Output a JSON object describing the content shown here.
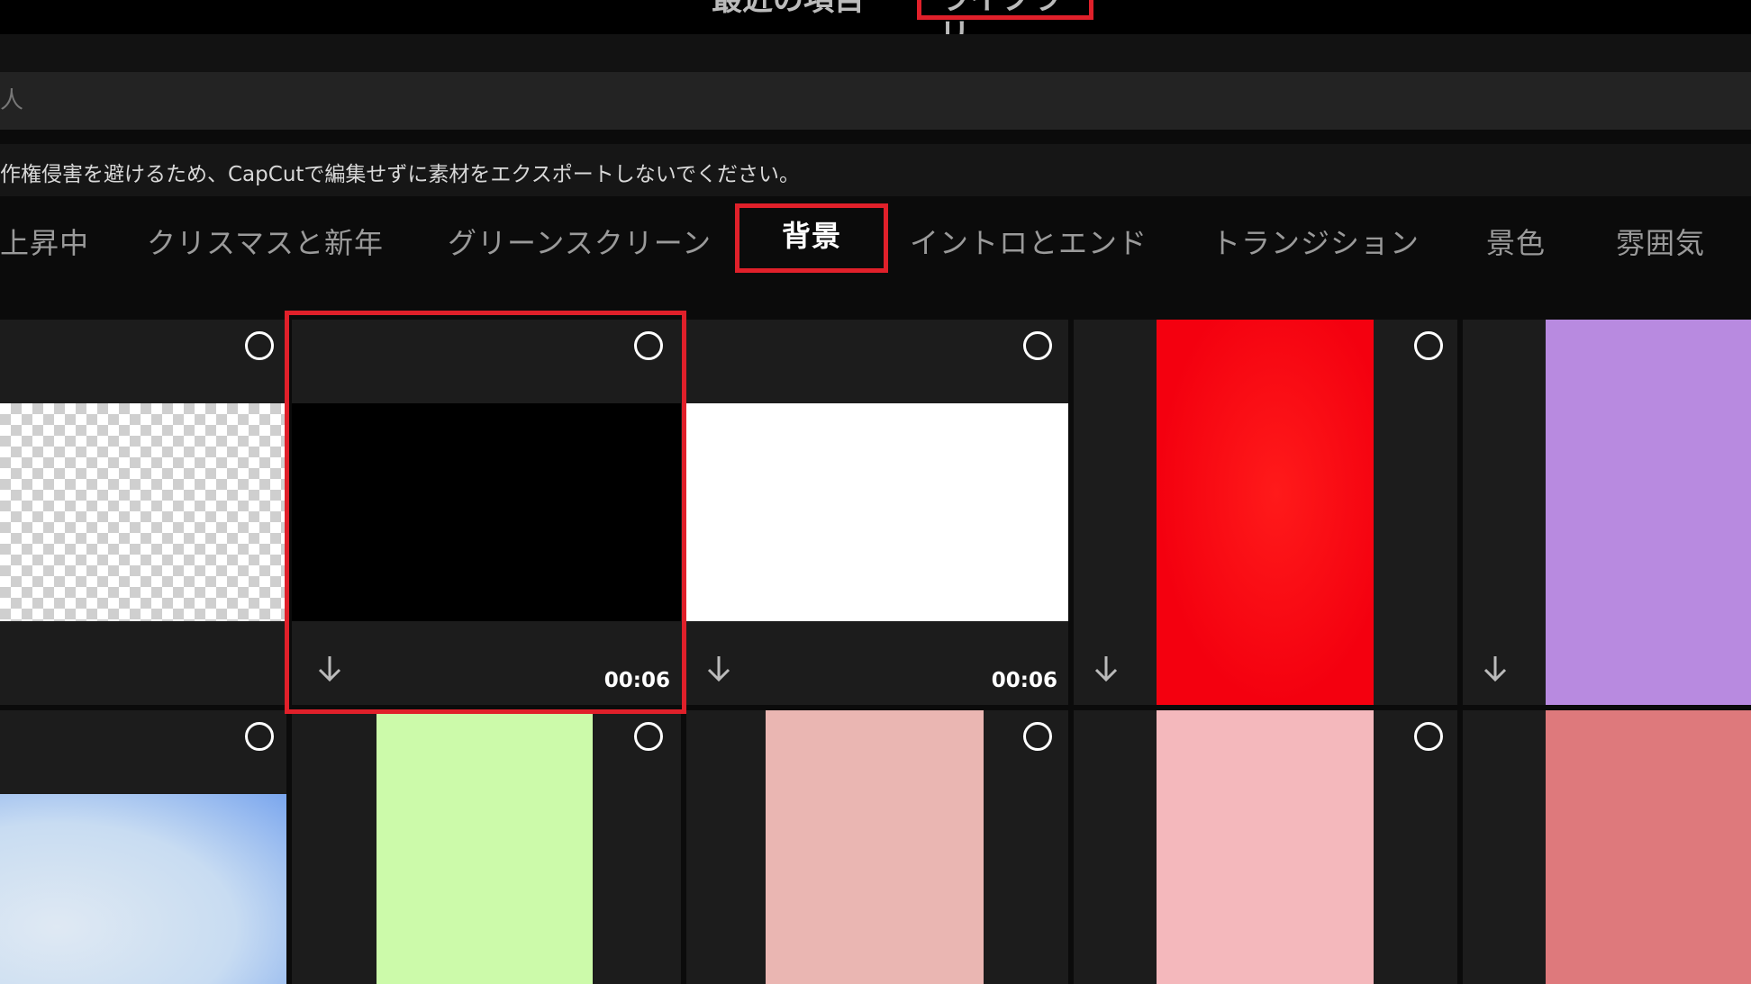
{
  "top_tabs": [
    {
      "label": "最近の項目"
    },
    {
      "label": "ライブラリ"
    }
  ],
  "search": {
    "placeholder": "人"
  },
  "notice": {
    "text": "作権侵害を避けるため、CapCutで編集せずに素材をエクスポートしないでください。"
  },
  "categories": [
    {
      "label": "上昇中"
    },
    {
      "label": "クリスマスと新年"
    },
    {
      "label": "グリーンスクリーン"
    },
    {
      "label": "背景",
      "active": true
    },
    {
      "label": "イントロとエンド"
    },
    {
      "label": "トランジション"
    },
    {
      "label": "景色"
    },
    {
      "label": "雰囲気"
    }
  ],
  "tiles": [
    {
      "type": "transparent",
      "duration": "",
      "selected": false
    },
    {
      "type": "black",
      "color": "#000000",
      "duration": "00:06",
      "selected": true
    },
    {
      "type": "white",
      "color": "#ffffff",
      "duration": "00:06",
      "selected": false
    },
    {
      "type": "red",
      "color": "#f4000f",
      "duration": "",
      "selected": false
    },
    {
      "type": "lavender",
      "color": "#b88ae0",
      "duration": "",
      "selected": false
    },
    {
      "type": "blue-gradient",
      "color": "#d6e6f5",
      "duration": "",
      "selected": false
    },
    {
      "type": "light-green",
      "color": "#ccfaaa",
      "duration": "",
      "selected": false
    },
    {
      "type": "dusty-pink",
      "color": "#eab6b2",
      "duration": "",
      "selected": false
    },
    {
      "type": "light-pink",
      "color": "#f4b8bc",
      "duration": "",
      "selected": false
    },
    {
      "type": "coral",
      "color": "#de797c",
      "duration": "",
      "selected": false
    }
  ],
  "colors": {
    "accent_red": "#e0202a",
    "tile_bg": "#1c1c1c"
  }
}
